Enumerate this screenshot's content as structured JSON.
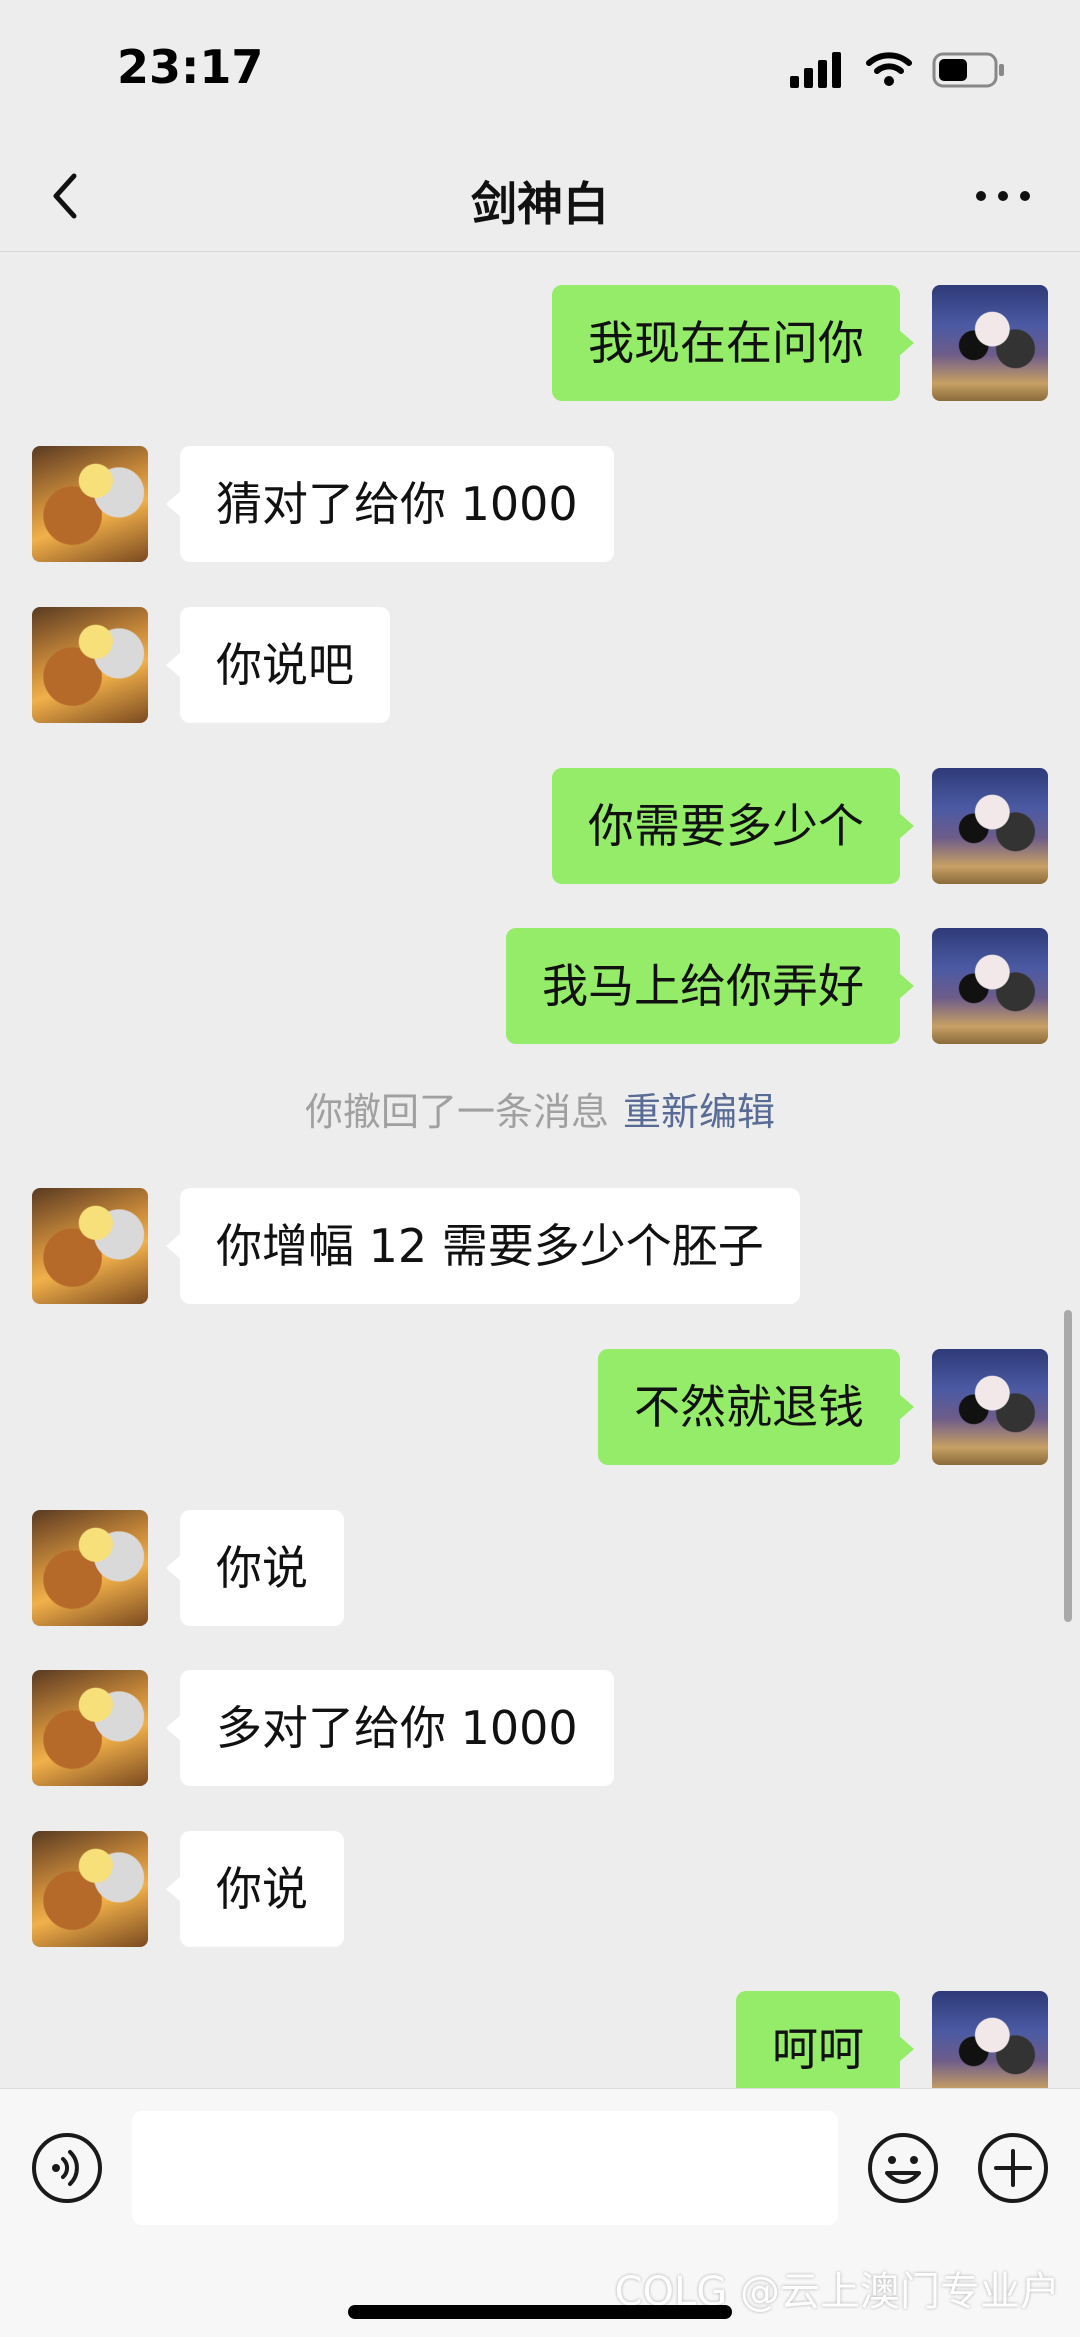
{
  "status_bar": {
    "time": "23:17",
    "icons": [
      "cellular-signal-icon",
      "wifi-icon",
      "battery-icon"
    ],
    "battery_level": 0.5
  },
  "header": {
    "back_icon": "chevron-left-icon",
    "title": "剑神白",
    "more_icon": "ellipsis-icon"
  },
  "chat": {
    "colors": {
      "sent_bubble": "#95ec69",
      "received_bubble": "#ffffff",
      "link": "#576b95"
    },
    "messages": [
      {
        "sender": "self",
        "text": "我现在在问你"
      },
      {
        "sender": "other",
        "text": "猜对了给你 1000"
      },
      {
        "sender": "other",
        "text": "你说吧"
      },
      {
        "sender": "self",
        "text": "你需要多少个"
      },
      {
        "sender": "self",
        "text": "我马上给你弄好"
      },
      {
        "sender": "other",
        "text": "你增幅 12 需要多少个胚子"
      },
      {
        "sender": "self",
        "text": "不然就退钱"
      },
      {
        "sender": "other",
        "text": "你说"
      },
      {
        "sender": "other",
        "text": "多对了给你 1000"
      },
      {
        "sender": "other",
        "text": "你说"
      },
      {
        "sender": "self",
        "text": "呵呵"
      }
    ],
    "system_notice": {
      "text": "你撤回了一条消息",
      "action": "重新编辑"
    }
  },
  "input_bar": {
    "voice_icon": "voice-icon",
    "emoji_icon": "emoji-icon",
    "plus_icon": "plus-icon",
    "input_value": ""
  },
  "watermark": "COLG @云上澳门专业户"
}
